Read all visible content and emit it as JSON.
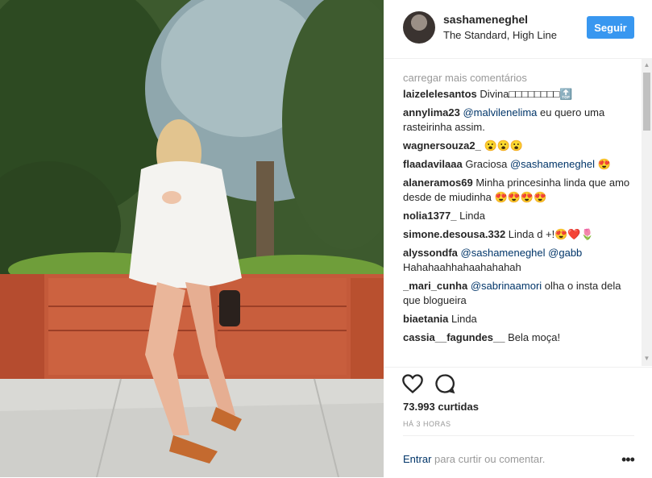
{
  "post": {
    "username": "sashameneghel",
    "location": "The Standard, High Line",
    "follow_label": "Seguir"
  },
  "comments": {
    "load_more": "carregar mais comentários",
    "items": [
      {
        "user": "laizelelesantos",
        "text": " Divina□□□□□□□□🔝"
      },
      {
        "user": "annylima23",
        "mention": "@malvilenelima",
        "text": " eu quero uma rasteirinha assim."
      },
      {
        "user": "wagnersouza2_",
        "text": " 😮😮😮"
      },
      {
        "user": "flaadavilaaa",
        "text": " Graciosa ",
        "mention2": "@sashameneghel",
        "tail": " 😍"
      },
      {
        "user": "alaneramos69",
        "text": " Minha princesinha linda que amo desde de miudinha 😍😍😍😍"
      },
      {
        "user": "nolia1377_",
        "text": " Linda"
      },
      {
        "user": "simone.desousa.332",
        "text": " Linda d +!😍❤️🌷"
      },
      {
        "user": "alyssondfa",
        "mention": "@sashameneghel",
        "mention_b": "@gabb",
        "text": " Hahahaahhahaahahahah"
      },
      {
        "user": "_mari_cunha",
        "mention": "@sabrinaamori",
        "text": " olha o insta dela que blogueira"
      },
      {
        "user": "biaetania",
        "text": " Linda"
      },
      {
        "user": "cassia__fagundes__",
        "text": " Bela moça!"
      }
    ]
  },
  "stats": {
    "likes": "73.993 curtidas",
    "time": "HÁ 3 HORAS"
  },
  "add_comment": {
    "login": "Entrar",
    "prompt": " para curtir ou comentar.",
    "more": "•••"
  },
  "icons": {
    "like": "heart-icon",
    "comment": "comment-icon"
  }
}
